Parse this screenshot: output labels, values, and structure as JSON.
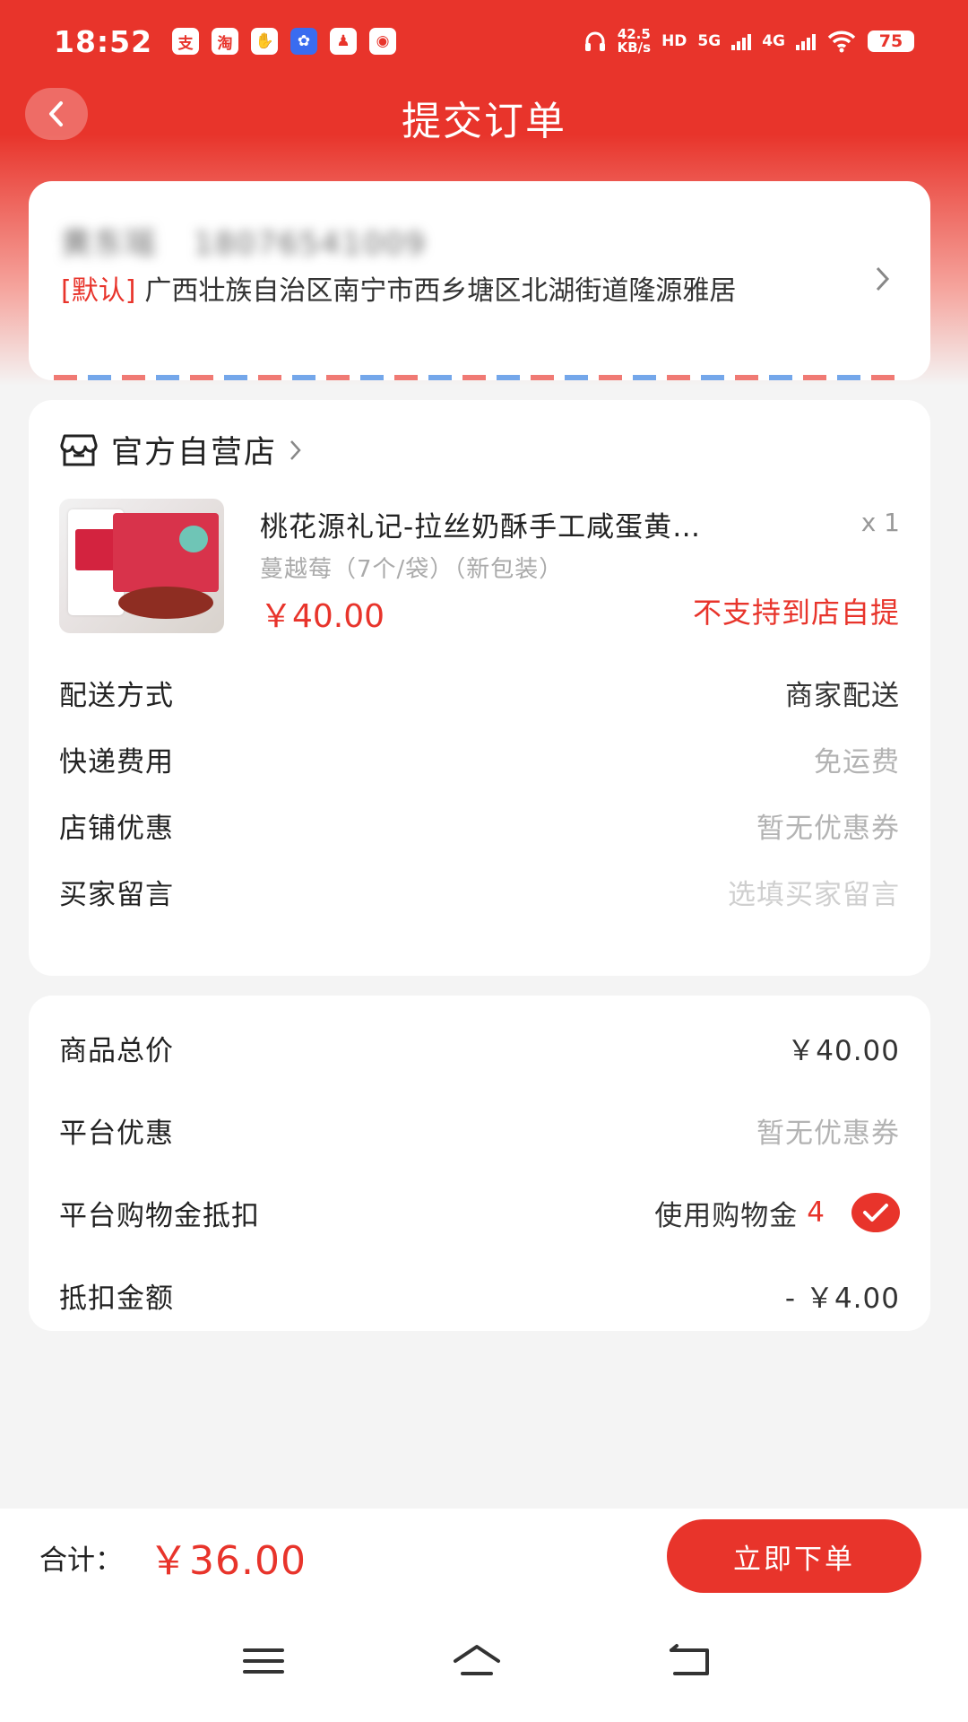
{
  "status_bar": {
    "time": "18:52",
    "apps": [
      "支",
      "淘",
      "✋",
      "✿",
      "♟",
      "◉"
    ],
    "net_speed_value": "42.5",
    "net_speed_unit": "KB/s",
    "hd_label": "HD",
    "network_5g": "5G",
    "network_4g": "4G",
    "battery": "75"
  },
  "nav": {
    "title": "提交订单"
  },
  "address": {
    "name": "黄东瑶",
    "phone": "18076541009",
    "tag": "[默认]",
    "detail": "广西壮族自治区南宁市西乡塘区北湖街道隆源雅居"
  },
  "shop": {
    "name": "官方自营店",
    "product": {
      "title": "桃花源礼记-拉丝奶酥手工咸蛋黄…",
      "qty": "x 1",
      "spec": "蔓越莓（7个/袋）（新包装）",
      "price": "￥40.00",
      "notice": "不支持到店自提"
    },
    "rows": [
      {
        "label": "配送方式",
        "value": "商家配送"
      },
      {
        "label": "快递费用",
        "value": "免运费"
      },
      {
        "label": "店铺优惠",
        "value": "暂无优惠券"
      },
      {
        "label": "买家留言",
        "value": "选填买家留言"
      }
    ]
  },
  "summary": {
    "rows": [
      {
        "label": "商品总价",
        "value": "￥40.00"
      },
      {
        "label": "平台优惠",
        "value": "暂无优惠券"
      },
      {
        "label": "平台购物金抵扣",
        "value": "使用购物金",
        "extra": "4",
        "checked": true
      },
      {
        "label": "抵扣金额",
        "value": "- ￥4.00"
      }
    ]
  },
  "bottom": {
    "total_label": "合计：",
    "total_amount": "￥36.00",
    "submit_label": "立即下单"
  },
  "colors": {
    "accent": "#e8342b",
    "background": "#f4f4f4"
  }
}
